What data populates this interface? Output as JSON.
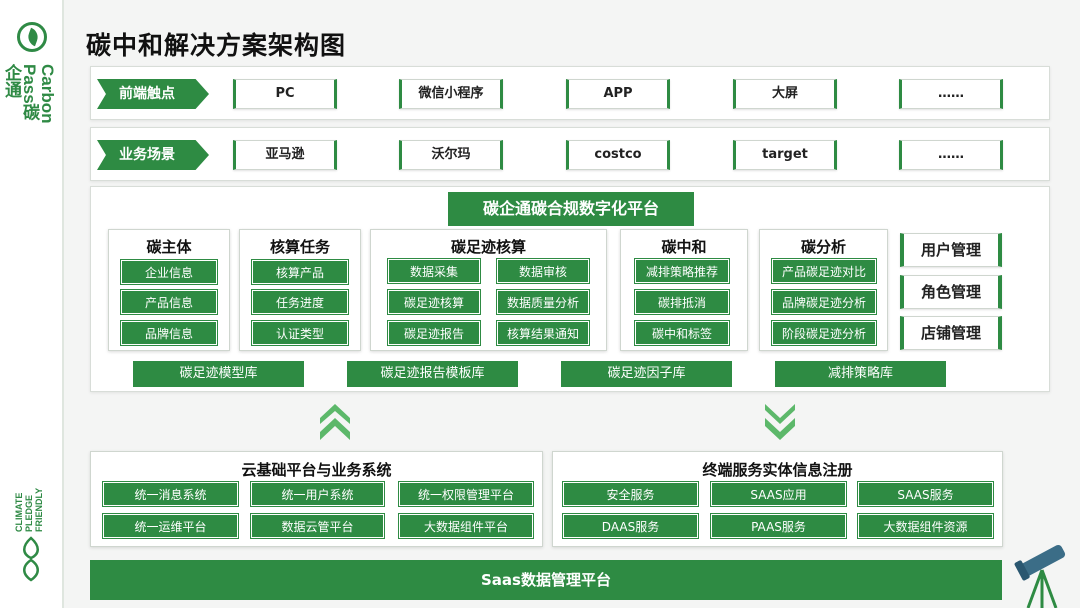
{
  "sidebar": {
    "logo_text": "Carbon Pass碳企通",
    "climate_text": "CLIMATE PLEDGE FRIENDLY"
  },
  "title": "碳中和解决方案架构图",
  "front_row": {
    "tag": "前端触点",
    "items": [
      "PC",
      "微信小程序",
      "APP",
      "大屏",
      "……"
    ]
  },
  "scene_row": {
    "tag": "业务场景",
    "items": [
      "亚马逊",
      "沃尔玛",
      "costco",
      "target",
      "……"
    ]
  },
  "platform": {
    "title": "碳企通碳合规数字化平台",
    "modules": [
      {
        "title": "碳主体",
        "items": [
          "企业信息",
          "产品信息",
          "品牌信息"
        ]
      },
      {
        "title": "核算任务",
        "items": [
          "核算产品",
          "任务进度",
          "认证类型"
        ]
      },
      {
        "title": "碳足迹核算",
        "items": [
          "数据采集",
          "数据审核",
          "碳足迹核算",
          "数据质量分析",
          "碳足迹报告",
          "核算结果通知"
        ]
      },
      {
        "title": "碳中和",
        "items": [
          "减排策略推荐",
          "碳排抵消",
          "碳中和标签"
        ]
      },
      {
        "title": "碳分析",
        "items": [
          "产品碳足迹对比",
          "品牌碳足迹分析",
          "阶段碳足迹分析"
        ]
      }
    ],
    "management": [
      "用户管理",
      "角色管理",
      "店铺管理"
    ],
    "libraries": [
      "碳足迹模型库",
      "碳足迹报告模板库",
      "碳足迹因子库",
      "减排策略库"
    ]
  },
  "cloud_panel": {
    "title": "云基础平台与业务系统",
    "items": [
      "统一消息系统",
      "统一用户系统",
      "统一权限管理平台",
      "统一运维平台",
      "数据云管平台",
      "大数据组件平台"
    ]
  },
  "terminal_panel": {
    "title": "终端服务实体信息注册",
    "items": [
      "安全服务",
      "SAAS应用",
      "SAAS服务",
      "DAAS服务",
      "PAAS服务",
      "大数据组件资源"
    ]
  },
  "saas_bar": "Saas数据管理平台",
  "colors": {
    "brand_green": "#2e8b43",
    "arrow_green": "#5cb86a"
  }
}
